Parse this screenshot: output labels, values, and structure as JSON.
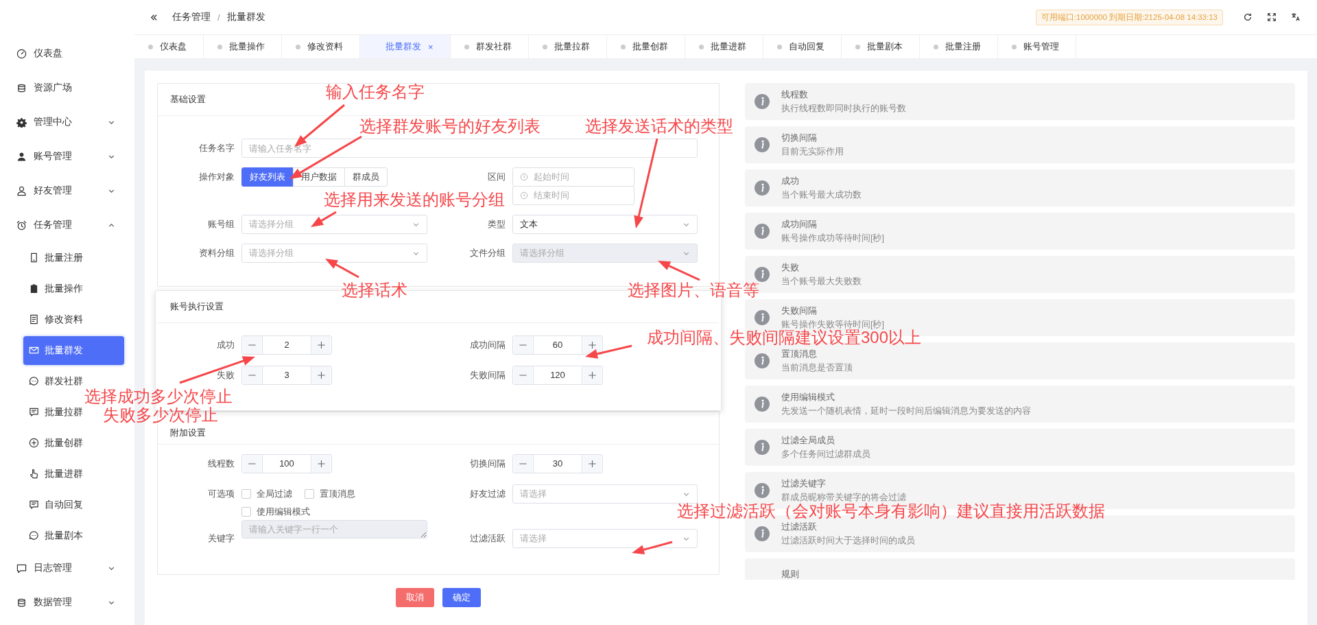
{
  "sidebar": {
    "items": [
      {
        "label": "仪表盘",
        "kind": "item",
        "selected": false
      },
      {
        "label": "资源广场",
        "kind": "item",
        "selected": false
      },
      {
        "label": "管理中心",
        "kind": "group",
        "expanded": false
      },
      {
        "label": "账号管理",
        "kind": "group",
        "expanded": false
      },
      {
        "label": "好友管理",
        "kind": "group",
        "expanded": false
      },
      {
        "label": "任务管理",
        "kind": "group",
        "expanded": true,
        "children": [
          {
            "label": "批量注册",
            "selected": false
          },
          {
            "label": "批量操作",
            "selected": false
          },
          {
            "label": "修改资料",
            "selected": false
          },
          {
            "label": "批量群发",
            "selected": true
          },
          {
            "label": "群发社群",
            "selected": false
          },
          {
            "label": "批量拉群",
            "selected": false
          },
          {
            "label": "批量创群",
            "selected": false
          },
          {
            "label": "批量进群",
            "selected": false
          },
          {
            "label": "自动回复",
            "selected": false
          },
          {
            "label": "批量剧本",
            "selected": false
          }
        ]
      },
      {
        "label": "日志管理",
        "kind": "group",
        "expanded": false
      },
      {
        "label": "数据管理",
        "kind": "group",
        "expanded": false
      }
    ]
  },
  "header": {
    "breadcrumb": [
      "任务管理",
      "批量群发"
    ],
    "separator": "/",
    "badge": "可用端口:1000000 到期日期:2125-04-08 14:33:13"
  },
  "tabs": {
    "close": "×",
    "items": [
      {
        "label": "仪表盘",
        "selected": false
      },
      {
        "label": "批量操作",
        "selected": false
      },
      {
        "label": "修改资料",
        "selected": false
      },
      {
        "label": "批量群发",
        "selected": true
      },
      {
        "label": "群发社群",
        "selected": false
      },
      {
        "label": "批量拉群",
        "selected": false
      },
      {
        "label": "批量创群",
        "selected": false
      },
      {
        "label": "批量进群",
        "selected": false
      },
      {
        "label": "自动回复",
        "selected": false
      },
      {
        "label": "批量剧本",
        "selected": false
      },
      {
        "label": "批量注册",
        "selected": false
      },
      {
        "label": "账号管理",
        "selected": false
      }
    ]
  },
  "form": {
    "panels": [
      {
        "title": "基础设置",
        "rows": [
          [
            {
              "label": "任务名字",
              "kind": "input",
              "placeholder": "请输入任务名字"
            }
          ],
          [
            {
              "label": "操作对象",
              "kind": "segmented",
              "options": [
                {
                  "label": "好友列表",
                  "selected": true
                },
                {
                  "label": "用户数据",
                  "selected": false
                },
                {
                  "label": "群成员",
                  "selected": false
                }
              ]
            },
            {
              "label": "区间",
              "kind": "daterange",
              "placeholders": [
                "起始时间",
                "结束时间"
              ]
            }
          ],
          [
            {
              "label": "账号组",
              "kind": "select",
              "placeholder": "请选择分组",
              "disabled": false
            },
            {
              "label": "类型",
              "kind": "select",
              "value": "文本",
              "disabled": false
            }
          ],
          [
            {
              "label": "资料分组",
              "kind": "select",
              "placeholder": "请选择分组",
              "disabled": false
            },
            {
              "label": "文件分组",
              "kind": "select",
              "placeholder": "请选择分组",
              "disabled": true
            }
          ]
        ]
      },
      {
        "title": "账号执行设置",
        "rows": [
          [
            {
              "label": "成功",
              "kind": "number",
              "value": "2"
            },
            {
              "label": "成功间隔",
              "kind": "number",
              "value": "60"
            }
          ],
          [
            {
              "label": "失败",
              "kind": "number",
              "value": "3"
            },
            {
              "label": "失败间隔",
              "kind": "number",
              "value": "120"
            }
          ]
        ]
      },
      {
        "title": "附加设置",
        "rows": [
          [
            {
              "label": "线程数",
              "kind": "number",
              "value": "100"
            },
            {
              "label": "切换间隔",
              "kind": "number",
              "value": "30"
            }
          ],
          [
            {
              "label": "可选项",
              "kind": "checkboxes",
              "options": [
                {
                  "label": "全局过滤",
                  "checked": false
                },
                {
                  "label": "置顶消息",
                  "checked": false
                },
                {
                  "label": "使用编辑模式",
                  "checked": false
                }
              ]
            },
            {
              "label": "好友过滤",
              "kind": "select",
              "placeholder": "请选择",
              "disabled": false
            }
          ],
          [
            {
              "label": "关键字",
              "kind": "textarea",
              "placeholder": "请输入关键字一行一个",
              "disabled": true
            },
            {
              "label": "过滤活跃",
              "kind": "select",
              "placeholder": "请选择",
              "disabled": false
            }
          ]
        ]
      }
    ],
    "buttons": [
      {
        "label": "取消",
        "kind": "danger"
      },
      {
        "label": "确定",
        "kind": "primary"
      }
    ]
  },
  "info": [
    {
      "title": "线程数",
      "desc": "执行线程数即同时执行的账号数"
    },
    {
      "title": "切换间隔",
      "desc": "目前无实际作用"
    },
    {
      "title": "成功",
      "desc": "当个账号最大成功数"
    },
    {
      "title": "成功间隔",
      "desc": "账号操作成功等待时间[秒]"
    },
    {
      "title": "失败",
      "desc": "当个账号最大失败数"
    },
    {
      "title": "失败间隔",
      "desc": "账号操作失败等待时间[秒]"
    },
    {
      "title": "置顶消息",
      "desc": "当前消息是否置顶"
    },
    {
      "title": "使用编辑模式",
      "desc": "先发送一个随机表情，延时一段时间后编辑消息为要发送的内容"
    },
    {
      "title": "过滤全局成员",
      "desc": "多个任务间过滤群成员"
    },
    {
      "title": "过滤关键字",
      "desc": "群成员昵称带关键字的将会过滤"
    },
    {
      "title": "过滤活跃",
      "desc": "过滤活跃时间大于选择时间的成员"
    },
    {
      "title": "规则"
    }
  ],
  "annotations": [
    {
      "text": "输入任务名字"
    },
    {
      "text": "选择群发账号的好友列表"
    },
    {
      "text": "选择发送话术的类型"
    },
    {
      "text": "选择用来发送的账号分组"
    },
    {
      "text": "选择话术"
    },
    {
      "text": "选择图片、语音等"
    },
    {
      "text": "成功间隔、失败间隔建议设置300以上"
    },
    {
      "text": "选择成功多少次停止"
    },
    {
      "text": "失败多少次停止"
    },
    {
      "text": "选择过滤活跃（会对账号本身有影响）建议直接用活跃数据"
    }
  ]
}
